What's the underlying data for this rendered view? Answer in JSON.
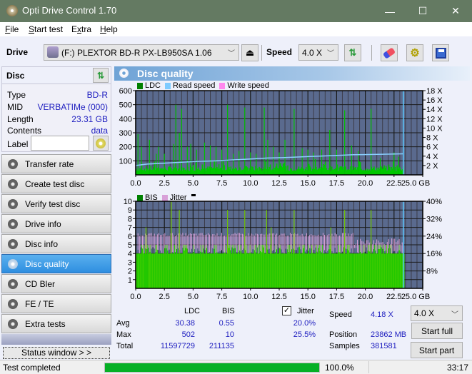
{
  "app": {
    "title": "Opti Drive Control 1.70"
  },
  "window_controls": {
    "minimize": "—",
    "maximize": "☐",
    "close": "✕"
  },
  "menu": [
    {
      "label": "File",
      "accel": "F",
      "rest": "ile"
    },
    {
      "label": "Start test",
      "accel": "S",
      "rest": "tart test"
    },
    {
      "label": "Extra",
      "accel": "E",
      "pre": "E",
      "accel2": "x",
      "rest": "tra"
    },
    {
      "label": "Help",
      "accel": "H",
      "rest": "elp"
    }
  ],
  "toolbar": {
    "drive_label": "Drive",
    "drive_value": "(F:)  PLEXTOR BD-R  PX-LB950SA 1.06",
    "speed_label": "Speed",
    "speed_value": "4.0 X"
  },
  "disc": {
    "header": "Disc",
    "fields": [
      {
        "key": "Type",
        "value": "BD-R"
      },
      {
        "key": "MID",
        "value": "VERBATIMe (000)"
      },
      {
        "key": "Length",
        "value": "23.31 GB"
      },
      {
        "key": "Contents",
        "value": "data"
      }
    ],
    "label_key": "Label",
    "label_value": ""
  },
  "nav": [
    {
      "label": "Transfer rate",
      "active": false
    },
    {
      "label": "Create test disc",
      "active": false
    },
    {
      "label": "Verify test disc",
      "active": false
    },
    {
      "label": "Drive info",
      "active": false
    },
    {
      "label": "Disc info",
      "active": false
    },
    {
      "label": "Disc quality",
      "active": true
    },
    {
      "label": "CD Bler",
      "active": false
    },
    {
      "label": "FE / TE",
      "active": false
    },
    {
      "label": "Extra tests",
      "active": false
    }
  ],
  "status_window_label": "Status window > >",
  "panel": {
    "title": "Disc quality"
  },
  "chart_data": [
    {
      "type": "bar",
      "title": "LDC",
      "legend": [
        "LDC",
        "Read speed",
        "Write speed"
      ],
      "colors": {
        "LDC": "#00c800",
        "Read speed": "#7ecbff",
        "Write speed": "#ff88ee"
      },
      "xlabel": "GB",
      "x_ticks": [
        "0.0",
        "2.5",
        "5.0",
        "7.5",
        "10.0",
        "12.5",
        "15.0",
        "17.5",
        "20.0",
        "22.5",
        "25.0 GB"
      ],
      "xlim": [
        0,
        25
      ],
      "y_ticks_left": [
        "100",
        "200",
        "300",
        "400",
        "500",
        "600"
      ],
      "ylim_left": [
        0,
        600
      ],
      "y_ticks_right": [
        "2 X",
        "4 X",
        "6 X",
        "8 X",
        "10 X",
        "12 X",
        "14 X",
        "16 X",
        "18 X"
      ],
      "ylim_right": [
        0,
        18
      ],
      "end_position_gb": 23.31,
      "ldc_baseline": 45,
      "ldc_spikes": [
        [
          0.2,
          290
        ],
        [
          0.5,
          200
        ],
        [
          1.2,
          250
        ],
        [
          1.8,
          150
        ],
        [
          2.0,
          200
        ],
        [
          2.5,
          150
        ],
        [
          3.3,
          220
        ],
        [
          3.5,
          500
        ],
        [
          3.8,
          300
        ],
        [
          4.0,
          470
        ],
        [
          4.5,
          200
        ],
        [
          4.8,
          220
        ],
        [
          5.3,
          180
        ],
        [
          6.0,
          230
        ],
        [
          6.5,
          210
        ],
        [
          7.0,
          200
        ],
        [
          7.5,
          180
        ],
        [
          8.0,
          500
        ],
        [
          8.5,
          150
        ],
        [
          9.0,
          170
        ],
        [
          9.5,
          480
        ],
        [
          10.0,
          160
        ],
        [
          10.5,
          150
        ],
        [
          11.2,
          480
        ],
        [
          11.5,
          250
        ],
        [
          12.0,
          200
        ],
        [
          12.5,
          160
        ],
        [
          13.0,
          250
        ],
        [
          13.8,
          470
        ],
        [
          14.5,
          190
        ],
        [
          15.0,
          180
        ],
        [
          15.5,
          160
        ],
        [
          16.2,
          180
        ],
        [
          16.9,
          320
        ],
        [
          17.5,
          180
        ],
        [
          18.2,
          460
        ],
        [
          18.8,
          210
        ],
        [
          19.4,
          170
        ],
        [
          20.5,
          470
        ],
        [
          21.3,
          120
        ],
        [
          22.5,
          160
        ],
        [
          22.9,
          130
        ]
      ],
      "read_speed": [
        [
          0,
          2.0
        ],
        [
          1,
          2.3
        ],
        [
          2.5,
          2.5
        ],
        [
          4,
          2.7
        ],
        [
          5.5,
          2.9
        ],
        [
          7,
          3.0
        ],
        [
          8.5,
          3.2
        ],
        [
          10,
          3.4
        ],
        [
          11.5,
          3.6
        ],
        [
          13,
          3.7
        ],
        [
          15,
          3.9
        ],
        [
          17,
          4.1
        ],
        [
          19,
          4.3
        ],
        [
          21.5,
          4.4
        ],
        [
          23.31,
          4.5
        ]
      ]
    },
    {
      "type": "bar",
      "title": "BIS / Jitter",
      "legend": [
        "BIS",
        "Jitter"
      ],
      "colors": {
        "BIS": "#00c800",
        "Jitter": "#d8a0d8"
      },
      "xlabel": "GB",
      "x_ticks": [
        "0.0",
        "2.5",
        "5.0",
        "7.5",
        "10.0",
        "12.5",
        "15.0",
        "17.5",
        "20.0",
        "22.5",
        "25.0 GB"
      ],
      "xlim": [
        0,
        25
      ],
      "y_ticks_left": [
        "1",
        "2",
        "3",
        "4",
        "5",
        "6",
        "7",
        "8",
        "9",
        "10"
      ],
      "ylim_left": [
        0,
        10
      ],
      "y_ticks_right": [
        "8%",
        "16%",
        "24%",
        "32%",
        "40%"
      ],
      "ylim_right": [
        0,
        40
      ],
      "end_position_gb": 23.31,
      "bis_baseline": 4,
      "bis_spikes": [
        [
          0.9,
          7
        ],
        [
          3.1,
          10
        ],
        [
          3.8,
          9
        ],
        [
          8.0,
          9
        ],
        [
          9.5,
          9
        ],
        [
          11.4,
          9
        ],
        [
          11.8,
          7
        ],
        [
          13.8,
          9
        ],
        [
          17.0,
          7
        ],
        [
          18.2,
          9
        ],
        [
          20.5,
          9
        ]
      ],
      "jitter_range_pct": [
        16,
        25.5
      ]
    }
  ],
  "stats": {
    "col_ldc": "LDC",
    "col_bis": "BIS",
    "jitter_label": "Jitter",
    "jitter_checked": true,
    "rows": [
      {
        "label": "Avg",
        "ldc": "30.38",
        "bis": "0.55",
        "jitter": "20.0%"
      },
      {
        "label": "Max",
        "ldc": "502",
        "bis": "10",
        "jitter": "25.5%"
      },
      {
        "label": "Total",
        "ldc": "11597729",
        "bis": "211135",
        "jitter": ""
      }
    ],
    "speed_label": "Speed",
    "speed_value": "4.18 X",
    "position_label": "Position",
    "position_value": "23862 MB",
    "samples_label": "Samples",
    "samples_value": "381581",
    "speed_select": "4.0 X",
    "start_full": "Start full",
    "start_part": "Start part"
  },
  "statusbar": {
    "text": "Test completed",
    "progress": 1.0,
    "progress_text": "100.0%",
    "time": "33:17"
  }
}
